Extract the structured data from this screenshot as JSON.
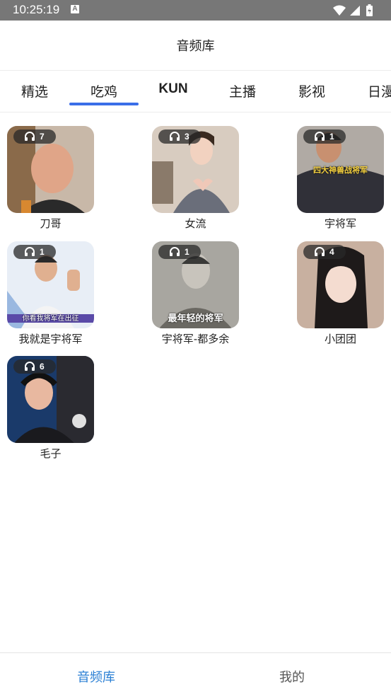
{
  "status_bar": {
    "time": "10:25:19",
    "notification_icon": "A"
  },
  "header": {
    "title": "音频库"
  },
  "tabs": [
    {
      "label": "精选",
      "active": false
    },
    {
      "label": "吃鸡",
      "active": true
    },
    {
      "label": "KUN",
      "active": false
    },
    {
      "label": "主播",
      "active": false
    },
    {
      "label": "影视",
      "active": false
    },
    {
      "label": "日漫",
      "active": false
    }
  ],
  "accent_color": "#3a6ee8",
  "items": [
    {
      "name": "刀哥",
      "count": "7",
      "overlay": ""
    },
    {
      "name": "女流",
      "count": "3",
      "overlay": ""
    },
    {
      "name": "宇将军",
      "count": "1",
      "overlay": "四大神兽战将军"
    },
    {
      "name": "我就是宇将军",
      "count": "1",
      "overlay": "你看我将军在出征"
    },
    {
      "name": "宇将军-都多余",
      "count": "1",
      "overlay": "最年轻的将军"
    },
    {
      "name": "小团团",
      "count": "4",
      "overlay": ""
    },
    {
      "name": "毛子",
      "count": "6",
      "overlay": ""
    }
  ],
  "bottom_nav": {
    "library": "音频库",
    "mine": "我的"
  }
}
